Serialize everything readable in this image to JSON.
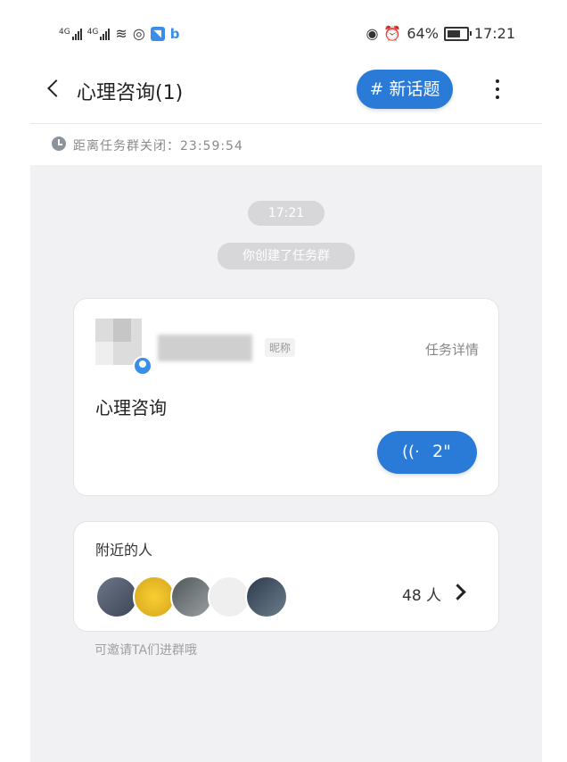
{
  "status_bar": {
    "signal1": "4G",
    "signal2": "4G",
    "battery": "64%",
    "time": "17:21",
    "icons": [
      "signal-icon",
      "signal-icon",
      "wifi-icon",
      "hotspot-icon",
      "app-icon",
      "baidu-icon",
      "eye-icon",
      "alarm-icon",
      "battery-icon"
    ]
  },
  "header": {
    "title": "心理咨询(1)",
    "new_topic_label": "# 新话题"
  },
  "countdown": {
    "label": "距离任务群关闭：",
    "time": "23:59:54",
    "text": "距离任务群关闭：23:59:54"
  },
  "system": {
    "time": "17:21",
    "created": "你创建了任务群"
  },
  "task_card": {
    "nickname_tag": "昵称",
    "detail_link": "任务详情",
    "task_title": "心理咨询",
    "voice_duration": "2\""
  },
  "nearby": {
    "title": "附近的人",
    "count": "48 人",
    "tip": "可邀请TA们进群哦"
  },
  "colors": {
    "accent": "#2a7ad8",
    "background": "#f1f1f3"
  }
}
